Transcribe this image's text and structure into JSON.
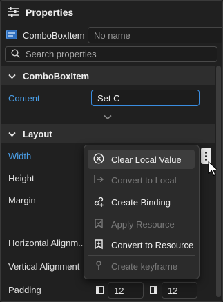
{
  "header": {
    "title": "Properties"
  },
  "element": {
    "type": "ComboBoxItem",
    "name_placeholder": "No name"
  },
  "search": {
    "placeholder": "Search properties"
  },
  "sections": {
    "combobox": {
      "label": "ComboBoxItem"
    },
    "layout": {
      "label": "Layout"
    }
  },
  "props": {
    "content": {
      "label": "Content",
      "value": "Set C"
    },
    "width": {
      "label": "Width"
    },
    "height": {
      "label": "Height"
    },
    "margin": {
      "label": "Margin"
    },
    "horizontal_alignment": {
      "label": "Horizontal Alignm..."
    },
    "vertical_alignment": {
      "label": "Vertical Alignment"
    },
    "padding": {
      "label": "Padding",
      "left": "12",
      "right": "12"
    }
  },
  "context_menu": {
    "items": [
      {
        "label": "Clear Local Value",
        "enabled": true,
        "icon": "clear-circle-icon"
      },
      {
        "label": "Convert to Local",
        "enabled": false,
        "icon": "convert-arrow-icon"
      },
      {
        "label": "Create Binding",
        "enabled": true,
        "icon": "link-plus-icon"
      },
      {
        "label": "Apply Resource",
        "enabled": false,
        "icon": "resource-apply-icon"
      },
      {
        "label": "Convert to Resource",
        "enabled": true,
        "icon": "resource-convert-icon"
      },
      {
        "label": "Create keyframe",
        "enabled": false,
        "icon": "keyframe-icon"
      }
    ]
  },
  "colors": {
    "accent": "#3a8de0",
    "label_blue": "#4a9fe8"
  }
}
